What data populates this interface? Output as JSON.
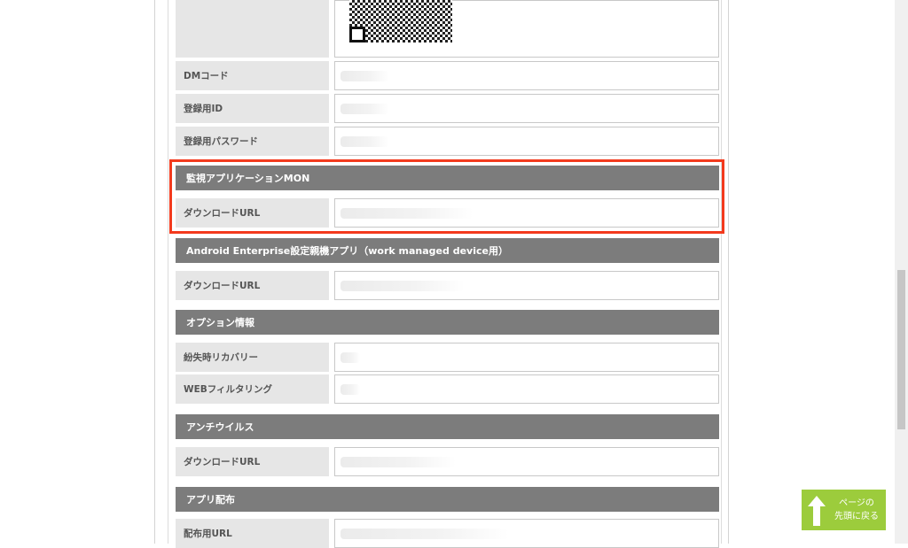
{
  "fields_top": [
    {
      "label": "DMコード"
    },
    {
      "label": "登録用ID"
    },
    {
      "label": "登録用パスワード"
    }
  ],
  "sections": [
    {
      "title": "監視アプリケーションMON",
      "rows": [
        {
          "label": "ダウンロードURL"
        }
      ]
    },
    {
      "title": "Android Enterprise設定親機アプリ（work managed device用）",
      "rows": [
        {
          "label": "ダウンロードURL"
        }
      ]
    },
    {
      "title": "オプション情報",
      "rows": [
        {
          "label": "紛失時リカバリー"
        },
        {
          "label": "WEBフィルタリング"
        }
      ]
    },
    {
      "title": "アンチウイルス",
      "rows": [
        {
          "label": "ダウンロードURL"
        }
      ]
    },
    {
      "title": "アプリ配布",
      "rows": [
        {
          "label": "配布用URL"
        }
      ]
    }
  ],
  "back_to_top": {
    "line1": "ページの",
    "line2": "先頭に戻る"
  },
  "colors": {
    "highlight": "#f33a1d",
    "section_header": "#7c7c7c",
    "back_to_top": "#9ccc3c",
    "label_bg": "#e6e6e6"
  }
}
